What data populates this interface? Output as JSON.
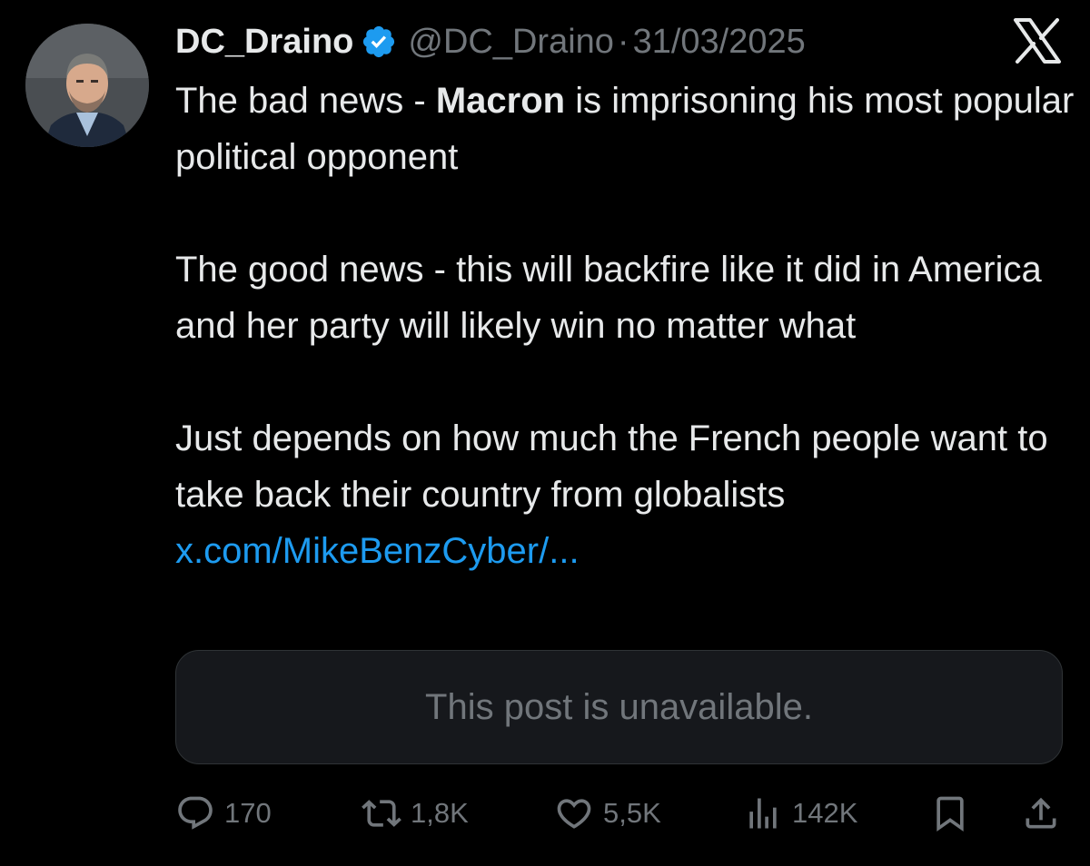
{
  "author": {
    "display_name": "DC_Draino",
    "handle": "@DC_Draino",
    "separator": "·",
    "date": "31/03/2025",
    "verified": true,
    "verified_color": "#1d9bf0"
  },
  "brand": {
    "logo_icon": "x-logo-icon"
  },
  "tweet": {
    "p1_part1": "The bad news - ",
    "p1_bold": "Macron",
    "p1_part2": " is imprisoning his most popular political opponent",
    "p2": "The good news - this will backfire like it did in America and her party will likely win no matter what",
    "p3_text": "Just depends on how much the French people want to take back their country from globalists ",
    "p3_link": "x.com/MikeBenzCyber/..."
  },
  "quoted_post": {
    "message": "This post is unavailable."
  },
  "actions": {
    "reply": {
      "icon": "reply-icon",
      "count": "170"
    },
    "repost": {
      "icon": "repost-icon",
      "count": "1,8K"
    },
    "like": {
      "icon": "heart-icon",
      "count": "5,5K"
    },
    "views": {
      "icon": "views-icon",
      "count": "142K"
    },
    "bookmark": {
      "icon": "bookmark-icon"
    },
    "share": {
      "icon": "share-icon"
    }
  },
  "colors": {
    "background": "#000000",
    "text": "#e7e9ea",
    "muted": "#71767b",
    "link": "#1d9bf0",
    "card_border": "#2f3336"
  }
}
